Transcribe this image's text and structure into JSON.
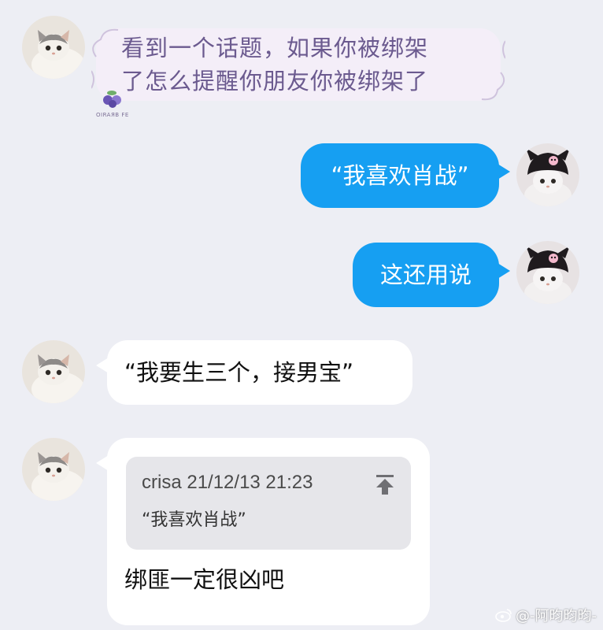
{
  "colors": {
    "background": "#edeef4",
    "sent_bubble": "#169ff2",
    "received_bubble": "#ffffff",
    "themed_text": "#6b5a8f"
  },
  "messages": [
    {
      "side": "left",
      "avatar": "cat-avatar-icon",
      "text": "看到一个话题，如果你被绑架了怎么提醒你朋友你被绑架了",
      "line1": "看到一个话题，如果你被绑架",
      "line2": "了怎么提醒你朋友你被绑架了",
      "sticker_text": "OIRAЯB FE"
    },
    {
      "side": "right",
      "avatar": "cat-hat-avatar-icon",
      "text": "“我喜欢肖战”"
    },
    {
      "side": "right",
      "avatar": "cat-hat-avatar-icon",
      "text": "这还用说"
    },
    {
      "side": "left",
      "avatar": "cat-avatar-icon",
      "text": "“我要生三个，接男宝”"
    },
    {
      "side": "left",
      "avatar": "cat-avatar-icon",
      "quote": {
        "author": "crisa",
        "time": "21/12/13 21:23",
        "text": "“我喜欢肖战”"
      },
      "text": "绑匪一定很凶吧"
    }
  ],
  "watermark": {
    "icon": "weibo-icon",
    "text": "@-阿昀昀昀-"
  }
}
